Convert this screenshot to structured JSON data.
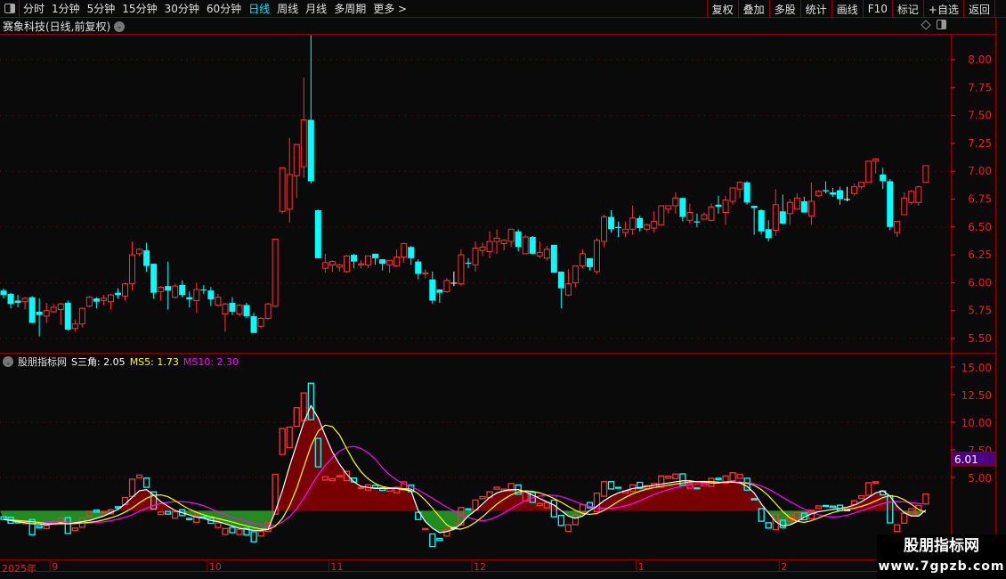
{
  "toolbar": {
    "periods": [
      "分时",
      "1分钟",
      "5分钟",
      "15分钟",
      "30分钟",
      "60分钟",
      "日线",
      "周线",
      "月线",
      "多周期",
      "更多 >"
    ],
    "active_period": "日线",
    "buttons": [
      "复权",
      "叠加",
      "多股",
      "统计",
      "画线",
      "F10",
      "标记",
      "+自选",
      "返回"
    ]
  },
  "main_title": "赛象科技(日线,前复权)",
  "indicator": {
    "name": "股朋指标网",
    "s_label": "S三角: 2.05",
    "ms5_label": "MS5: 1.73",
    "ms10_label": "MS10: 2.30",
    "current_value_label": "6.01"
  },
  "date_axis": [
    {
      "label": "2025年",
      "index": 0
    },
    {
      "label": "9",
      "index": 7
    },
    {
      "label": "10",
      "index": 29
    },
    {
      "label": "11",
      "index": 46
    },
    {
      "label": "12",
      "index": 66
    },
    {
      "label": "1",
      "index": 89
    },
    {
      "label": "2",
      "index": 109
    }
  ],
  "watermark": {
    "line1": "股朋指标网",
    "line2": "www.7gpzb.com"
  },
  "colors": {
    "up": "#ff3232",
    "down": "#00ffff",
    "doji": "#ffffff",
    "axis": "#e02020",
    "grid": "#8b0000",
    "s_line": "#ffffff",
    "ms5": "#ffff00",
    "ms10": "#ff00ff",
    "fill_above": "#780000",
    "fill_below": "#228b22",
    "current_label_bg": "#4b0082"
  },
  "chart_data": [
    {
      "type": "candlestick",
      "title": "赛象科技(日线,前复权)",
      "ylim": [
        5.4,
        8.25
      ],
      "yticks": [
        "5.50",
        "5.75",
        "6.00",
        "6.25",
        "6.50",
        "6.75",
        "7.00",
        "7.25",
        "7.50",
        "7.75",
        "8.00"
      ],
      "grid_every": 0.5,
      "ohlc": [
        [
          5.93,
          5.95,
          5.86,
          5.89
        ],
        [
          5.9,
          5.91,
          5.77,
          5.81
        ],
        [
          5.84,
          5.89,
          5.78,
          5.82
        ],
        [
          5.83,
          5.87,
          5.76,
          5.86
        ],
        [
          5.87,
          5.88,
          5.64,
          5.64
        ],
        [
          5.74,
          5.86,
          5.52,
          5.71
        ],
        [
          5.7,
          5.82,
          5.64,
          5.75
        ],
        [
          5.74,
          5.81,
          5.73,
          5.78
        ],
        [
          5.76,
          5.82,
          5.62,
          5.81
        ],
        [
          5.82,
          5.84,
          5.57,
          5.58
        ],
        [
          5.59,
          5.67,
          5.56,
          5.63
        ],
        [
          5.63,
          5.78,
          5.6,
          5.77
        ],
        [
          5.79,
          5.88,
          5.78,
          5.87
        ],
        [
          5.86,
          5.87,
          5.77,
          5.83
        ],
        [
          5.84,
          5.89,
          5.8,
          5.86
        ],
        [
          5.83,
          5.9,
          5.76,
          5.89
        ],
        [
          5.91,
          5.95,
          5.86,
          5.89
        ],
        [
          5.88,
          6.0,
          5.84,
          5.99
        ],
        [
          5.99,
          6.37,
          5.93,
          6.25
        ],
        [
          6.26,
          6.31,
          6.24,
          6.3
        ],
        [
          6.29,
          6.36,
          6.1,
          6.15
        ],
        [
          6.17,
          6.17,
          5.86,
          5.91
        ],
        [
          5.92,
          5.97,
          5.84,
          5.96
        ],
        [
          5.97,
          6.19,
          5.76,
          5.93
        ],
        [
          5.87,
          5.99,
          5.86,
          5.97
        ],
        [
          5.98,
          6.02,
          5.87,
          5.89
        ],
        [
          5.87,
          5.92,
          5.78,
          5.85
        ],
        [
          5.84,
          6.0,
          5.73,
          5.94
        ],
        [
          5.94,
          5.98,
          5.9,
          5.93
        ],
        [
          5.93,
          5.96,
          5.79,
          5.85
        ],
        [
          5.8,
          5.9,
          5.79,
          5.87
        ],
        [
          5.72,
          5.82,
          5.56,
          5.81
        ],
        [
          5.82,
          5.87,
          5.71,
          5.74
        ],
        [
          5.72,
          5.81,
          5.7,
          5.8
        ],
        [
          5.8,
          5.82,
          5.68,
          5.7
        ],
        [
          5.7,
          5.73,
          5.55,
          5.55
        ],
        [
          5.61,
          5.69,
          5.59,
          5.68
        ],
        [
          5.68,
          5.82,
          5.67,
          5.81
        ],
        [
          5.79,
          6.39,
          5.78,
          6.39
        ],
        [
          6.64,
          7.03,
          6.62,
          7.03
        ],
        [
          6.66,
          7.3,
          6.54,
          6.97
        ],
        [
          6.96,
          7.24,
          6.76,
          7.24
        ],
        [
          7.04,
          7.84,
          6.94,
          7.46
        ],
        [
          7.46,
          8.22,
          6.89,
          6.91
        ],
        [
          6.65,
          6.66,
          6.22,
          6.22
        ],
        [
          6.13,
          6.26,
          6.09,
          6.18
        ],
        [
          6.16,
          6.2,
          6.1,
          6.19
        ],
        [
          6.14,
          6.17,
          6.1,
          6.16
        ],
        [
          6.1,
          6.25,
          6.09,
          6.24
        ],
        [
          6.25,
          6.26,
          6.13,
          6.19
        ],
        [
          6.16,
          6.2,
          6.13,
          6.17
        ],
        [
          6.16,
          6.24,
          6.13,
          6.24
        ],
        [
          6.26,
          6.26,
          6.16,
          6.22
        ],
        [
          6.21,
          6.21,
          6.11,
          6.17
        ],
        [
          6.16,
          6.2,
          6.09,
          6.2
        ],
        [
          6.15,
          6.3,
          6.14,
          6.23
        ],
        [
          6.23,
          6.36,
          6.18,
          6.35
        ],
        [
          6.32,
          6.33,
          6.16,
          6.22
        ],
        [
          6.19,
          6.21,
          6.03,
          6.08
        ],
        [
          6.08,
          6.12,
          6.04,
          6.09
        ],
        [
          6.03,
          6.1,
          5.81,
          5.84
        ],
        [
          5.94,
          5.94,
          5.82,
          5.91
        ],
        [
          5.92,
          6.04,
          5.91,
          6.02
        ],
        [
          6.0,
          6.1,
          5.97,
          6.0
        ],
        [
          5.99,
          6.3,
          5.97,
          6.25
        ],
        [
          6.18,
          6.22,
          6.13,
          6.17
        ],
        [
          6.16,
          6.37,
          6.1,
          6.31
        ],
        [
          6.29,
          6.36,
          6.24,
          6.32
        ],
        [
          6.28,
          6.46,
          6.22,
          6.37
        ],
        [
          6.37,
          6.48,
          6.26,
          6.4
        ],
        [
          6.35,
          6.39,
          6.29,
          6.38
        ],
        [
          6.37,
          6.48,
          6.32,
          6.48
        ],
        [
          6.46,
          6.48,
          6.28,
          6.32
        ],
        [
          6.26,
          6.43,
          6.26,
          6.41
        ],
        [
          6.41,
          6.42,
          6.26,
          6.26
        ],
        [
          6.24,
          6.37,
          6.22,
          6.27
        ],
        [
          6.22,
          6.33,
          6.2,
          6.3
        ],
        [
          6.34,
          6.34,
          6.09,
          6.09
        ],
        [
          6.1,
          6.1,
          5.77,
          5.95
        ],
        [
          5.89,
          6.12,
          5.88,
          5.99
        ],
        [
          6.0,
          6.15,
          5.96,
          6.15
        ],
        [
          6.15,
          6.3,
          6.13,
          6.26
        ],
        [
          6.22,
          6.22,
          6.11,
          6.14
        ],
        [
          6.1,
          6.4,
          6.08,
          6.38
        ],
        [
          6.37,
          6.61,
          6.32,
          6.59
        ],
        [
          6.59,
          6.65,
          6.45,
          6.48
        ],
        [
          6.5,
          6.55,
          6.41,
          6.49
        ],
        [
          6.45,
          6.55,
          6.41,
          6.48
        ],
        [
          6.48,
          6.69,
          6.43,
          6.58
        ],
        [
          6.58,
          6.6,
          6.46,
          6.49
        ],
        [
          6.48,
          6.53,
          6.46,
          6.52
        ],
        [
          6.49,
          6.64,
          6.45,
          6.55
        ],
        [
          6.52,
          6.69,
          6.52,
          6.69
        ],
        [
          6.66,
          6.69,
          6.62,
          6.69
        ],
        [
          6.69,
          6.81,
          6.62,
          6.76
        ],
        [
          6.76,
          6.76,
          6.55,
          6.59
        ],
        [
          6.56,
          6.71,
          6.53,
          6.63
        ],
        [
          6.55,
          6.62,
          6.5,
          6.54
        ],
        [
          6.57,
          6.63,
          6.57,
          6.61
        ],
        [
          6.56,
          6.71,
          6.55,
          6.68
        ],
        [
          6.7,
          6.78,
          6.62,
          6.68
        ],
        [
          6.63,
          6.78,
          6.52,
          6.74
        ],
        [
          6.73,
          6.85,
          6.7,
          6.85
        ],
        [
          6.84,
          6.91,
          6.76,
          6.9
        ],
        [
          6.9,
          6.91,
          6.7,
          6.72
        ],
        [
          6.69,
          6.69,
          6.43,
          6.67
        ],
        [
          6.65,
          6.66,
          6.43,
          6.46
        ],
        [
          6.48,
          6.56,
          6.37,
          6.4
        ],
        [
          6.47,
          6.84,
          6.42,
          6.7
        ],
        [
          6.64,
          6.79,
          6.53,
          6.53
        ],
        [
          6.62,
          6.75,
          6.52,
          6.72
        ],
        [
          6.66,
          6.8,
          6.66,
          6.76
        ],
        [
          6.73,
          6.77,
          6.63,
          6.63
        ],
        [
          6.6,
          6.9,
          6.52,
          6.73
        ],
        [
          6.78,
          6.83,
          6.77,
          6.82
        ],
        [
          6.83,
          6.91,
          6.8,
          6.82
        ],
        [
          6.81,
          6.85,
          6.77,
          6.79
        ],
        [
          6.83,
          6.86,
          6.7,
          6.75
        ],
        [
          6.75,
          6.86,
          6.73,
          6.75
        ],
        [
          6.8,
          6.89,
          6.78,
          6.86
        ],
        [
          6.86,
          6.9,
          6.84,
          6.9
        ],
        [
          6.9,
          7.09,
          6.9,
          7.09
        ],
        [
          7.09,
          7.11,
          6.98,
          7.11
        ],
        [
          6.97,
          7.03,
          6.84,
          6.91
        ],
        [
          6.91,
          6.93,
          6.47,
          6.5
        ],
        [
          6.45,
          6.55,
          6.41,
          6.55
        ],
        [
          6.61,
          6.81,
          6.61,
          6.76
        ],
        [
          6.72,
          6.83,
          6.7,
          6.82
        ],
        [
          6.72,
          6.87,
          6.69,
          6.86
        ],
        [
          6.9,
          7.05,
          6.9,
          7.05
        ]
      ]
    },
    {
      "type": "line",
      "ylim": [
        -2.8,
        16
      ],
      "yticks": [
        "5.00",
        "7.50",
        "10.00",
        "12.50",
        "15.00"
      ],
      "grid_values": [
        5,
        10
      ],
      "fill_baseline": 2.0,
      "series": [
        {
          "name": "S三角",
          "values": [
            1.2,
            1.1,
            1.0,
            0.9,
            0.8,
            0.8,
            0.7,
            0.8,
            0.9,
            0.8,
            0.9,
            1.0,
            1.1,
            1.3,
            1.5,
            1.8,
            2.1,
            2.6,
            3.2,
            3.8,
            3.9,
            3.4,
            2.8,
            2.4,
            2.0,
            1.8,
            1.6,
            1.4,
            1.3,
            1.1,
            1.0,
            0.8,
            0.6,
            0.4,
            0.3,
            0.2,
            0.2,
            0.3,
            1.9,
            3.8,
            6.0,
            8.0,
            10.0,
            11.5,
            10.4,
            8.8,
            7.3,
            6.2,
            5.3,
            4.6,
            4.2,
            4.1,
            4.0,
            4.0,
            4.0,
            4.0,
            3.9,
            3.8,
            2.0,
            1.0,
            0.4,
            0.0,
            0.1,
            0.3,
            0.8,
            1.5,
            2.0,
            2.6,
            3.2,
            3.6,
            3.8,
            3.9,
            3.9,
            3.7,
            3.4,
            3.1,
            2.8,
            2.5,
            2.0,
            1.5,
            1.3,
            1.5,
            2.0,
            2.4,
            2.9,
            3.3,
            3.6,
            3.8,
            4.0,
            4.1,
            4.2,
            4.3,
            4.4,
            4.5,
            4.6,
            4.7,
            4.7,
            4.6,
            4.6,
            4.5,
            4.5,
            4.6,
            4.6,
            4.5,
            4.2,
            3.6,
            2.6,
            1.8,
            1.0,
            0.6,
            0.7,
            1.0,
            1.4,
            1.7,
            1.9,
            2.0,
            2.1,
            2.2,
            2.3,
            2.5,
            2.8,
            3.2,
            3.6,
            3.8,
            3.3,
            2.4,
            1.8,
            1.5,
            1.5,
            2.05
          ]
        },
        {
          "name": "MS5",
          "window": 5
        },
        {
          "name": "MS10",
          "window": 10
        }
      ]
    }
  ]
}
